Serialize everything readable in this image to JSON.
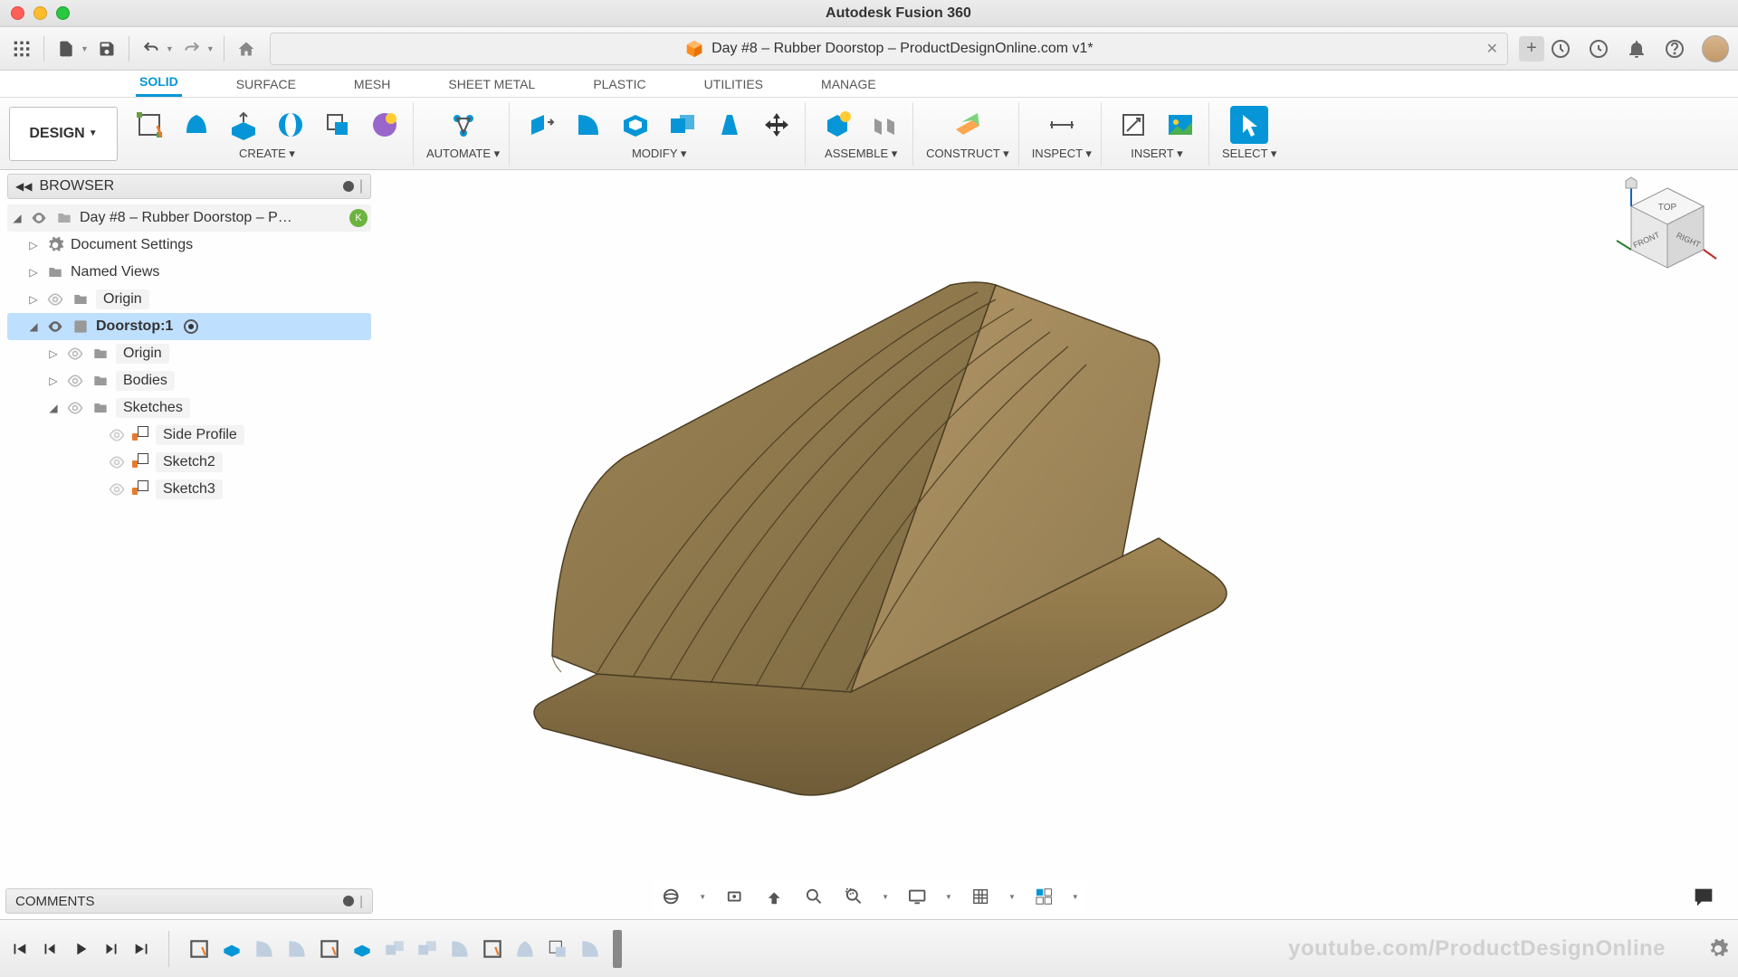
{
  "app_title": "Autodesk Fusion 360",
  "doc_tab": "Day #8 – Rubber Doorstop – ProductDesignOnline.com v1*",
  "design_button": "DESIGN",
  "ribbon_tabs": [
    "SOLID",
    "SURFACE",
    "MESH",
    "SHEET METAL",
    "PLASTIC",
    "UTILITIES",
    "MANAGE"
  ],
  "ribbon_groups": {
    "create": "CREATE",
    "automate": "AUTOMATE",
    "modify": "MODIFY",
    "assemble": "ASSEMBLE",
    "construct": "CONSTRUCT",
    "inspect": "INSPECT",
    "insert": "INSERT",
    "select": "SELECT"
  },
  "browser": {
    "title": "BROWSER",
    "root": "Day #8 – Rubber Doorstop – P…",
    "doc_settings": "Document Settings",
    "named_views": "Named Views",
    "origin": "Origin",
    "component": "Doorstop:1",
    "comp_origin": "Origin",
    "bodies": "Bodies",
    "sketches": "Sketches",
    "sketch_items": [
      "Side Profile",
      "Sketch2",
      "Sketch3"
    ]
  },
  "comments": "COMMENTS",
  "viewcube": {
    "top": "TOP",
    "front": "FRONT",
    "right": "RIGHT"
  },
  "watermark": "youtube.com/ProductDesignOnline"
}
